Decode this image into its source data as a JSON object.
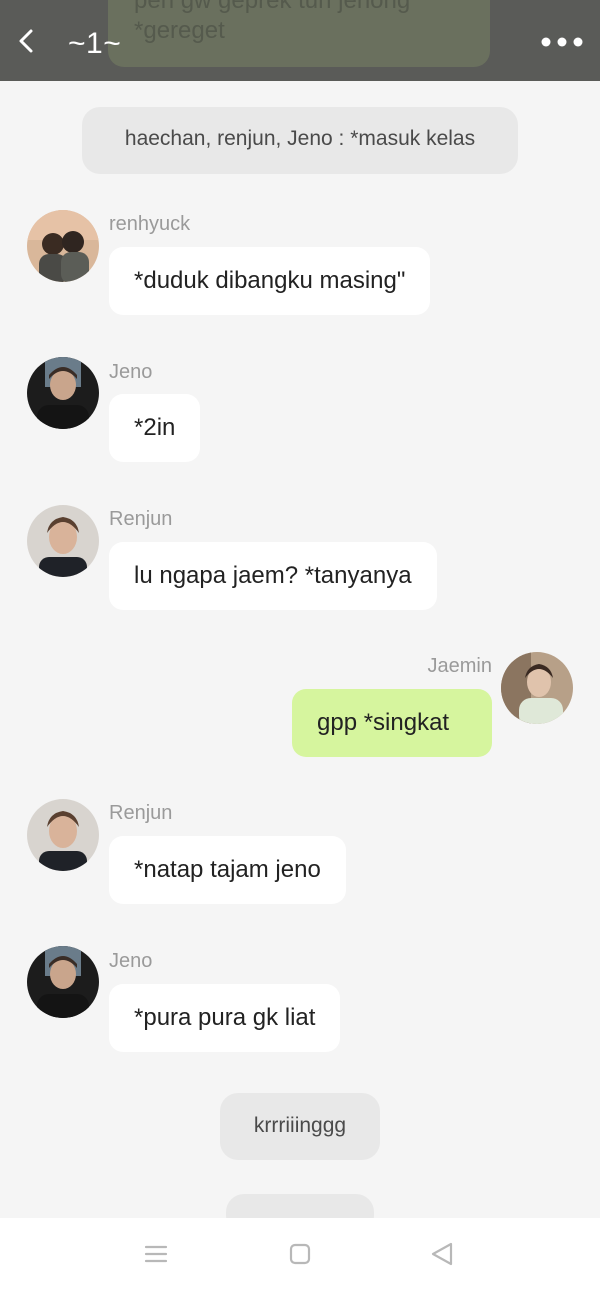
{
  "header": {
    "title": "~1~",
    "behind_text": "pen gw geprek tuh jenong\n*gereget",
    "back_icon": "chevron-left-icon",
    "more_icon": "more-dots-icon",
    "background": "#5a5b58"
  },
  "messages": [
    {
      "type": "system",
      "text": "haechan, renjun, Jeno : *masuk kelas"
    },
    {
      "type": "incoming",
      "sender": "renhyuck",
      "text": "*duduk dibangku masing\"",
      "avatar": "couple-avatar"
    },
    {
      "type": "incoming",
      "sender": "Jeno",
      "text": "*2in",
      "avatar": "jeno-avatar"
    },
    {
      "type": "incoming",
      "sender": "Renjun",
      "text": "lu ngapa jaem? *tanyanya",
      "avatar": "renjun-avatar"
    },
    {
      "type": "outgoing",
      "sender": "Jaemin",
      "text": "gpp *singkat",
      "avatar": "jaemin-avatar"
    },
    {
      "type": "incoming",
      "sender": "Renjun",
      "text": "*natap tajam jeno",
      "avatar": "renjun-avatar"
    },
    {
      "type": "incoming",
      "sender": "Jeno",
      "text": "*pura pura gk liat",
      "avatar": "jeno-avatar"
    },
    {
      "type": "system",
      "text": "krrriiinggg"
    }
  ],
  "navbar": {
    "icons": [
      "menu-icon",
      "home-square-icon",
      "back-triangle-icon"
    ]
  },
  "colors": {
    "outgoing_bubble": "#d6f59e",
    "incoming_bubble": "#ffffff",
    "system_bubble": "#e8e8e8",
    "background": "#f5f5f5"
  }
}
